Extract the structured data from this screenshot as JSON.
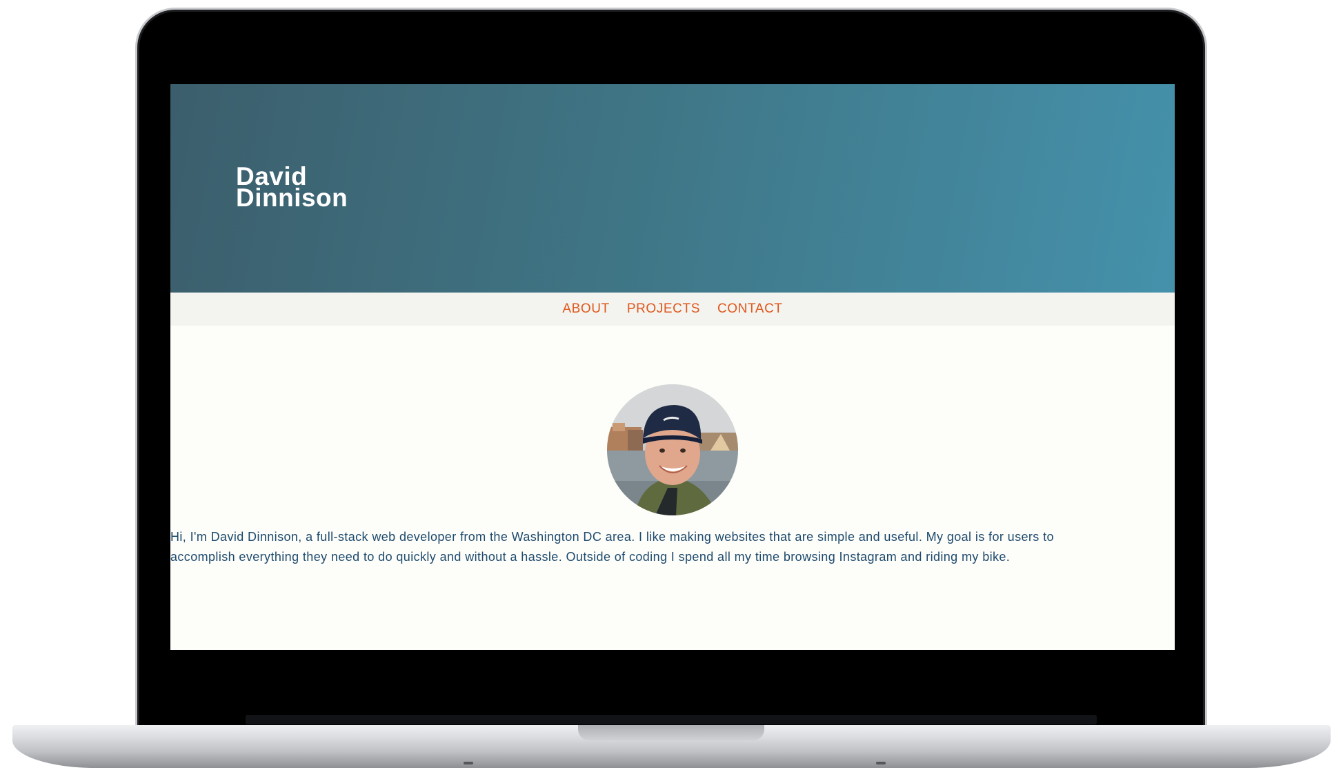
{
  "site": {
    "title_line1": "David",
    "title_line2": "Dinnison"
  },
  "nav": {
    "items": [
      {
        "label": "ABOUT"
      },
      {
        "label": "PROJECTS"
      },
      {
        "label": "CONTACT"
      }
    ]
  },
  "about": {
    "bio": "Hi, I'm David Dinnison, a full-stack web developer from the Washington DC area. I like making websites that are simple and useful. My goal is for users to accomplish everything they need to do quickly and without a hassle. Outside of coding I spend all my time browsing Instagram and riding my bike."
  },
  "colors": {
    "hero_start": "#3c5e6c",
    "hero_end": "#4591ab",
    "nav_link": "#e0571b",
    "bio_text": "#1d4a6d",
    "page_bg": "#fdfdf9"
  }
}
